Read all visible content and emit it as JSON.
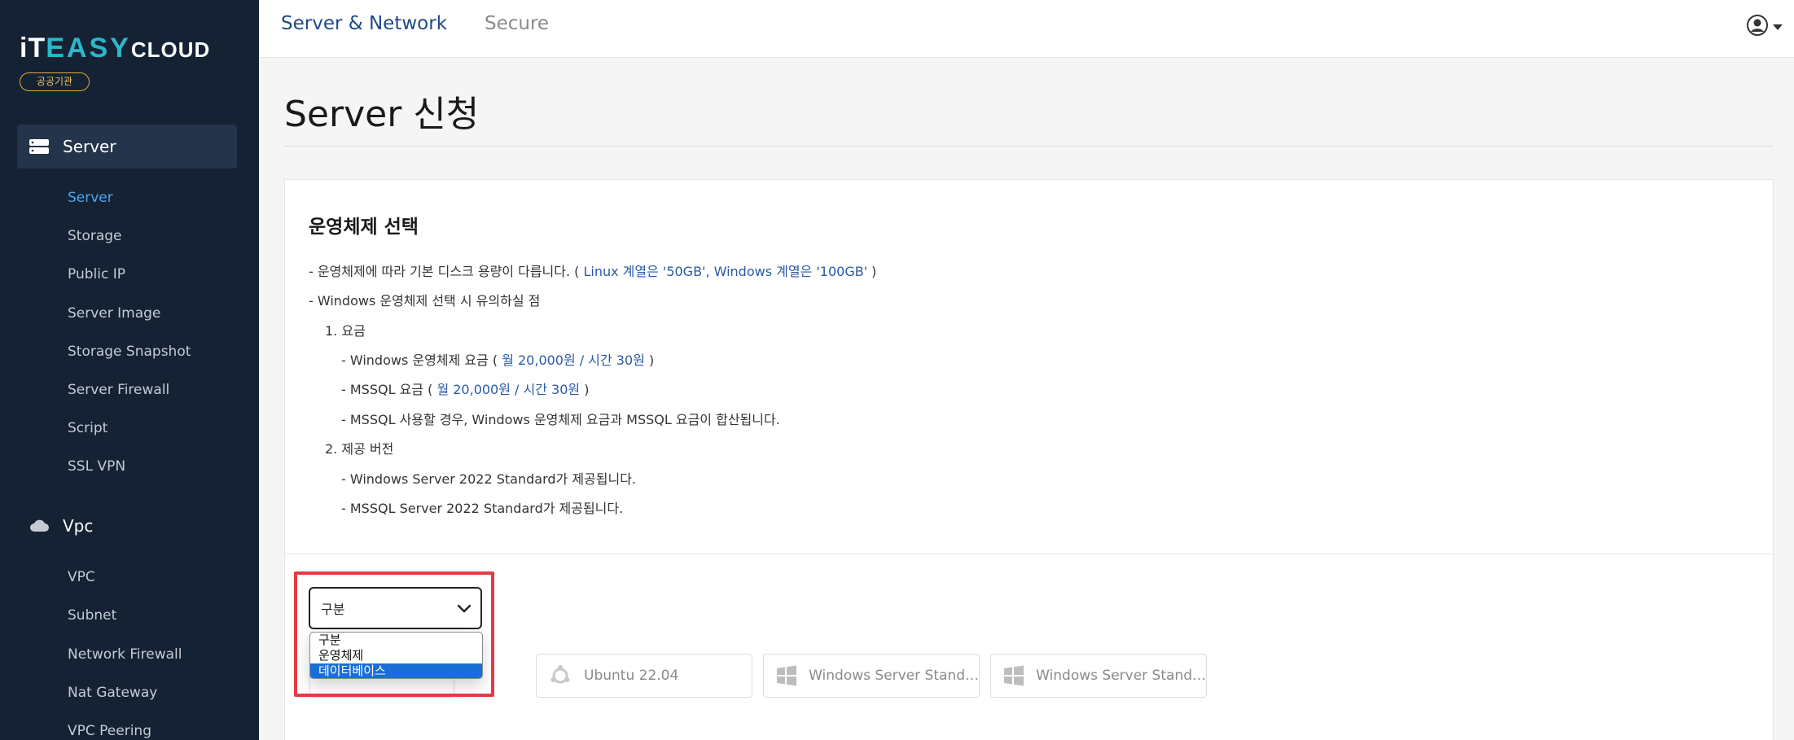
{
  "brand": {
    "logo_prefix": "iT",
    "logo_mid": "EASY",
    "logo_suffix": "CLOUD",
    "badge": "공공기관",
    "logo_accent": "#2bb8c9",
    "badge_color": "#e2a93b"
  },
  "sidebar": {
    "groups": [
      {
        "label": "Server",
        "icon": "server-icon",
        "items": [
          "Server",
          "Storage",
          "Public IP",
          "Server Image",
          "Storage Snapshot",
          "Server Firewall",
          "Script",
          "SSL VPN"
        ]
      },
      {
        "label": "Vpc",
        "icon": "cloud-icon",
        "items": [
          "VPC",
          "Subnet",
          "Network Firewall",
          "Nat Gateway",
          "VPC Peering"
        ]
      }
    ],
    "active_item": "Server",
    "active_color": "#4ea3f0"
  },
  "topbar": {
    "tabs": [
      "Server & Network",
      "Secure"
    ],
    "active_tab": "Server & Network",
    "user_icon": "user-circle-icon"
  },
  "page": {
    "title": "Server 신청"
  },
  "os_section": {
    "title": "운영체제 선택",
    "note1_prefix": "- 운영체제에 따라 기본 디스크 용량이 다릅니다. ( ",
    "note1_highlight": "Linux 계열은 '50GB', Windows 계열은 '100GB'",
    "note1_suffix": " )",
    "note2": "- Windows 운영체제 선택 시 유의하실 점",
    "fee_heading": "1. 요금",
    "fee_windows_prefix": "- Windows 운영체제 요금 ( ",
    "fee_windows_highlight": "월 20,000원 / 시간 30원",
    "fee_windows_suffix": " )",
    "fee_mssql_prefix": "- MSSQL 요금 ( ",
    "fee_mssql_highlight": "월 20,000원 / 시간 30원",
    "fee_mssql_suffix": " )",
    "fee_combined": "- MSSQL 사용할 경우, Windows 운영체제 요금과 MSSQL 요금이 합산됩니다.",
    "version_heading": "2. 제공 버전",
    "version_windows": "- Windows Server 2022 Standard가 제공됩니다.",
    "version_mssql": "- MSSQL Server 2022 Standard가 제공됩니다.",
    "highlight_color": "#2a5aa5"
  },
  "category_select": {
    "selected": "구분",
    "options": [
      "구분",
      "운영체제",
      "데이터베이스"
    ],
    "highlighted_option": "데이터베이스",
    "highlight_color": "#1a6fd6"
  },
  "os_cards": [
    {
      "label": "Ubuntu 22.04",
      "icon": "ubuntu-icon"
    },
    {
      "label": "Windows Server Stand…",
      "icon": "windows-icon"
    },
    {
      "label": "Windows Server Stand…",
      "icon": "windows-icon"
    }
  ],
  "annotation_color": "#e63946"
}
